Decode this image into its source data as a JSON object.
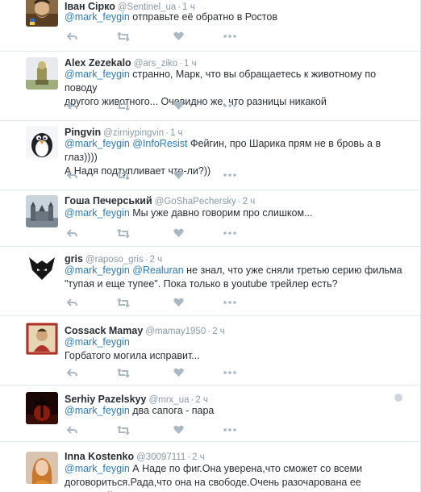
{
  "tweets": [
    {
      "name": "Іван Сірко",
      "handle": "@Sentinel_ua",
      "time": "1 ч",
      "mentions": [
        "@mark_feygin"
      ],
      "lines": [
        "отправьте её обратно в Ростов"
      ],
      "avatar": "cossack-portrait-avatar"
    },
    {
      "name": "Alex Zezekalo",
      "handle": "@ars_ziko",
      "time": "1 ч",
      "mentions": [
        "@mark_feygin"
      ],
      "lines": [
        "странно,  Марк,  что вы обращаетесь к животному по поводу",
        "другого животного... Очевидно же,  что разницы никакой"
      ],
      "avatar": "figure-avatar"
    },
    {
      "name": "Pingvin",
      "handle": "@zirniypingvin",
      "time": "1 ч",
      "mentions": [
        "@mark_feygin",
        "@InfoResist"
      ],
      "lines": [
        "Фейгин, про Шарика прям не в бровь а в глаз))))",
        "А Надя подтупливает что-ли?))"
      ],
      "avatar": "penguin-avatar"
    },
    {
      "name": "Гоша Печерський",
      "handle": "@GoShaPechersky",
      "time": "2 ч",
      "mentions": [
        "@mark_feygin"
      ],
      "lines": [
        "Мы уже давно говорим про слишком..."
      ],
      "avatar": "castle-avatar"
    },
    {
      "name": "gris",
      "handle": "@raposo_gris",
      "time": "2 ч",
      "mentions": [
        "@mark_feygin",
        "@Realuran"
      ],
      "lines": [
        "не знал, что уже сняли третью серию фильма",
        "\"тупая и еще тупее\". Пока только в youtube трейлер есть?"
      ],
      "avatar": "wolf-avatar"
    },
    {
      "name": "Cossack Mamay",
      "handle": "@mamay1950",
      "time": "2 ч",
      "mentions": [
        "@mark_feygin"
      ],
      "lines": [
        "",
        "Горбатого могила исправит..."
      ],
      "avatar": "cossack-mamay-avatar"
    },
    {
      "name": "Serhiy Pazelskyy",
      "handle": "@mrx_ua",
      "time": "2 ч",
      "mentions": [
        "@mark_feygin"
      ],
      "lines": [
        "два сапога - пара"
      ],
      "avatar": "cross-avatar"
    },
    {
      "name": "Inna Kostenko",
      "handle": "@30097111",
      "time": "2 ч",
      "mentions": [
        "@mark_feygin"
      ],
      "lines": [
        "А Наде по фиг.Она уверена,что сможет со всеми",
        "договориться.Рада,что она на свободе.Очень разочарована ее политикой."
      ],
      "avatar": "woman-avatar"
    }
  ],
  "icons": {
    "reply": "reply-icon",
    "retweet": "retweet-icon",
    "like": "heart-icon",
    "more": "more-dots-icon"
  },
  "colors": {
    "link": "#2b7bb9",
    "muted": "#8899a6",
    "icon": "#aab8c2",
    "divider": "#e1e8ed"
  }
}
